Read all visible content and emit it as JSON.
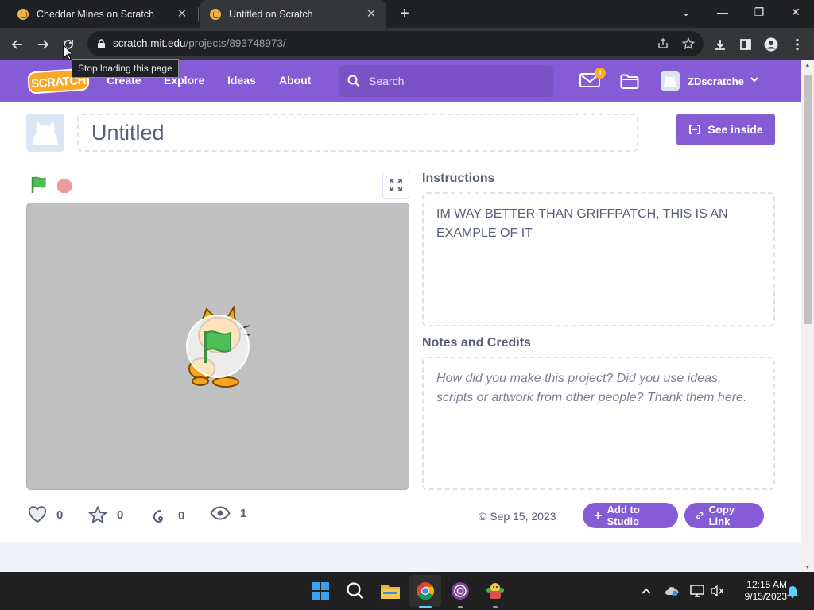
{
  "browser": {
    "tabs": [
      {
        "title": "Cheddar Mines on Scratch",
        "close": "✕"
      },
      {
        "title": "Untitled on Scratch",
        "close": "✕"
      }
    ],
    "new_tab": "+",
    "window_controls": {
      "dropdown": "⌄",
      "minimize": "—",
      "restore": "❐",
      "close": "✕"
    },
    "url_host": "scratch.mit.edu",
    "url_path": "/projects/893748973/",
    "tooltip": "Stop loading this page"
  },
  "nav": {
    "logo": "SCRATCH",
    "links": [
      "Create",
      "Explore",
      "Ideas",
      "About"
    ],
    "search_placeholder": "Search",
    "message_count": "1",
    "username": "ZDscratche"
  },
  "project": {
    "title": "Untitled",
    "see_inside": "See inside",
    "instructions_label": "Instructions",
    "instructions": "IM WAY BETTER THAN GRIFFPATCH, THIS IS AN EXAMPLE OF IT",
    "notes_label": "Notes and Credits",
    "notes_placeholder": "How did you make this project? Did you use ideas, scripts or artwork from other people? Thank them here.",
    "stats": {
      "loves": "0",
      "favorites": "0",
      "remixes": "0",
      "views": "1"
    },
    "date": "Sep 15, 2023",
    "add_to_studio": "Add to Studio",
    "copy_link": "Copy Link"
  },
  "taskbar": {
    "time": "12:15 AM",
    "date": "9/15/2023"
  },
  "colors": {
    "scratch_purple": "#855cd6",
    "text": "#575e75",
    "flag_green": "#4cbf56",
    "stop_red": "#ec9c9c"
  }
}
